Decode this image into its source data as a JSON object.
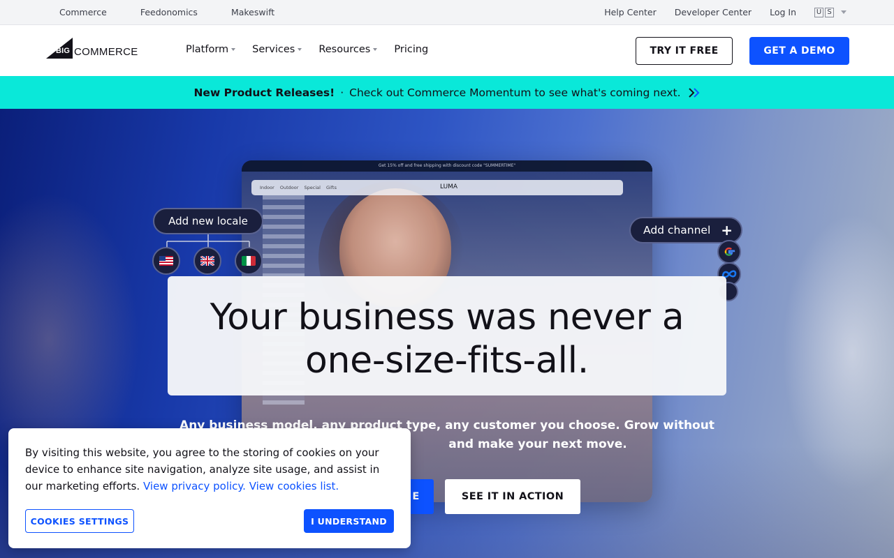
{
  "utility_bar": {
    "left_links": [
      "Commerce",
      "Feedonomics",
      "Makeswift"
    ],
    "right_links": [
      "Help Center",
      "Developer Center",
      "Log In"
    ],
    "locale": [
      "U",
      "S"
    ]
  },
  "header": {
    "logo": {
      "big": "BIG",
      "word": "COMMERCE"
    },
    "nav": [
      {
        "label": "Platform",
        "has_menu": true
      },
      {
        "label": "Services",
        "has_menu": true
      },
      {
        "label": "Resources",
        "has_menu": true
      },
      {
        "label": "Pricing",
        "has_menu": false
      }
    ],
    "try_label": "TRY IT FREE",
    "demo_label": "GET A DEMO"
  },
  "announcement": {
    "bold": "New Product Releases!",
    "separator": "·",
    "text": "Check out Commerce Momentum to see what's coming next."
  },
  "hero": {
    "mockup": {
      "promo": "Get 15% off and free shipping with discount code \"SUMMERTIME\"",
      "nav_links": [
        "Indoor",
        "Outdoor",
        "Special",
        "Gifts"
      ],
      "brand": "LUMA"
    },
    "locale_pill": "Add new locale",
    "channel_pill": "Add channel",
    "channel_plus": "+",
    "headline_line1": "Your business was never a",
    "headline_line2": "one-size-fits-all.",
    "subtext_line1": "Any business model, any product type, any customer you choose. Grow without",
    "subtext_line2": "and make your next move.",
    "primary_button_visible": "E",
    "secondary_button": "SEE IT IN ACTION"
  },
  "cookie_banner": {
    "text": "By visiting this website, you agree to the storing of cookies on your device to enhance site navigation, analyze site usage, and assist in our marketing efforts.",
    "privacy_link": "View privacy policy.",
    "cookies_link": "View cookies list.",
    "settings_label": "COOKIES SETTINGS",
    "accept_label": "I UNDERSTAND"
  },
  "colors": {
    "brand_blue": "#0d52ff",
    "announcement_bg": "#0ae8d9",
    "text_dark": "#121118"
  }
}
